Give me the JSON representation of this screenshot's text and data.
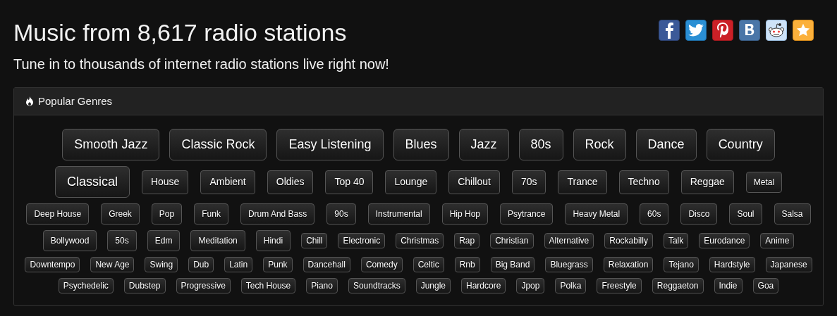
{
  "heading": "Music from 8,617 radio stations",
  "subheading": "Tune in to thousands of internet radio stations live right now!",
  "share_icons": [
    {
      "kind": "facebook"
    },
    {
      "kind": "twitter"
    },
    {
      "kind": "pinterest"
    },
    {
      "kind": "vk"
    },
    {
      "kind": "reddit"
    },
    {
      "kind": "favorite"
    }
  ],
  "panel": {
    "title": "Popular Genres",
    "genre_rows": [
      [
        {
          "label": "Smooth Jazz",
          "kind": "xl"
        },
        {
          "label": "Classic Rock",
          "kind": "xl"
        },
        {
          "label": "Easy Listening",
          "kind": "xl"
        },
        {
          "label": "Blues",
          "kind": "xl"
        },
        {
          "label": "Jazz",
          "kind": "xl"
        },
        {
          "label": "80s",
          "kind": "xl"
        },
        {
          "label": "Rock",
          "kind": "xl"
        },
        {
          "label": "Dance",
          "kind": "xl"
        },
        {
          "label": "Country",
          "kind": "xl"
        }
      ],
      [
        {
          "label": "Classical",
          "kind": "xl"
        },
        {
          "label": "House",
          "kind": "lg"
        },
        {
          "label": "Ambient",
          "kind": "lg"
        },
        {
          "label": "Oldies",
          "kind": "lg"
        },
        {
          "label": "Top 40",
          "kind": "lg"
        },
        {
          "label": "Lounge",
          "kind": "lg"
        },
        {
          "label": "Chillout",
          "kind": "lg"
        },
        {
          "label": "70s",
          "kind": "lg"
        },
        {
          "label": "Trance",
          "kind": "lg"
        },
        {
          "label": "Techno",
          "kind": "lg"
        },
        {
          "label": "Reggae",
          "kind": "lg"
        },
        {
          "label": "Metal",
          "kind": "md"
        }
      ],
      [
        {
          "label": "Deep House",
          "kind": "md"
        },
        {
          "label": "Greek",
          "kind": "md"
        },
        {
          "label": "Pop",
          "kind": "md"
        },
        {
          "label": "Funk",
          "kind": "md"
        },
        {
          "label": "Drum And Bass",
          "kind": "md"
        },
        {
          "label": "90s",
          "kind": "md"
        },
        {
          "label": "Instrumental",
          "kind": "md"
        },
        {
          "label": "Hip Hop",
          "kind": "md"
        },
        {
          "label": "Psytrance",
          "kind": "md"
        },
        {
          "label": "Heavy Metal",
          "kind": "md"
        },
        {
          "label": "60s",
          "kind": "md"
        },
        {
          "label": "Disco",
          "kind": "md"
        },
        {
          "label": "Soul",
          "kind": "md"
        },
        {
          "label": "Salsa",
          "kind": "md"
        }
      ],
      [
        {
          "label": "Bollywood",
          "kind": "md"
        },
        {
          "label": "50s",
          "kind": "md"
        },
        {
          "label": "Edm",
          "kind": "md"
        },
        {
          "label": "Meditation",
          "kind": "md"
        },
        {
          "label": "Hindi",
          "kind": "md"
        },
        {
          "label": "Chill",
          "kind": "sm"
        },
        {
          "label": "Electronic",
          "kind": "sm"
        },
        {
          "label": "Christmas",
          "kind": "sm"
        },
        {
          "label": "Rap",
          "kind": "sm"
        },
        {
          "label": "Christian",
          "kind": "sm"
        },
        {
          "label": "Alternative",
          "kind": "sm"
        },
        {
          "label": "Rockabilly",
          "kind": "sm"
        },
        {
          "label": "Talk",
          "kind": "sm"
        },
        {
          "label": "Eurodance",
          "kind": "sm"
        },
        {
          "label": "Anime",
          "kind": "sm"
        }
      ],
      [
        {
          "label": "Downtempo",
          "kind": "sm"
        },
        {
          "label": "New Age",
          "kind": "sm"
        },
        {
          "label": "Swing",
          "kind": "sm"
        },
        {
          "label": "Dub",
          "kind": "sm"
        },
        {
          "label": "Latin",
          "kind": "sm"
        },
        {
          "label": "Punk",
          "kind": "sm"
        },
        {
          "label": "Dancehall",
          "kind": "sm"
        },
        {
          "label": "Comedy",
          "kind": "sm"
        },
        {
          "label": "Celtic",
          "kind": "sm"
        },
        {
          "label": "Rnb",
          "kind": "sm"
        },
        {
          "label": "Big Band",
          "kind": "sm"
        },
        {
          "label": "Bluegrass",
          "kind": "sm"
        },
        {
          "label": "Relaxation",
          "kind": "sm"
        },
        {
          "label": "Tejano",
          "kind": "sm"
        },
        {
          "label": "Hardstyle",
          "kind": "sm"
        },
        {
          "label": "Japanese",
          "kind": "sm"
        }
      ],
      [
        {
          "label": "Psychedelic",
          "kind": "sm"
        },
        {
          "label": "Dubstep",
          "kind": "sm"
        },
        {
          "label": "Progressive",
          "kind": "sm"
        },
        {
          "label": "Tech House",
          "kind": "sm"
        },
        {
          "label": "Piano",
          "kind": "sm"
        },
        {
          "label": "Soundtracks",
          "kind": "sm"
        },
        {
          "label": "Jungle",
          "kind": "sm"
        },
        {
          "label": "Hardcore",
          "kind": "sm"
        },
        {
          "label": "Jpop",
          "kind": "sm"
        },
        {
          "label": "Polka",
          "kind": "sm"
        },
        {
          "label": "Freestyle",
          "kind": "sm"
        },
        {
          "label": "Reggaeton",
          "kind": "sm"
        },
        {
          "label": "Indie",
          "kind": "sm"
        },
        {
          "label": "Goa",
          "kind": "sm"
        }
      ]
    ]
  }
}
